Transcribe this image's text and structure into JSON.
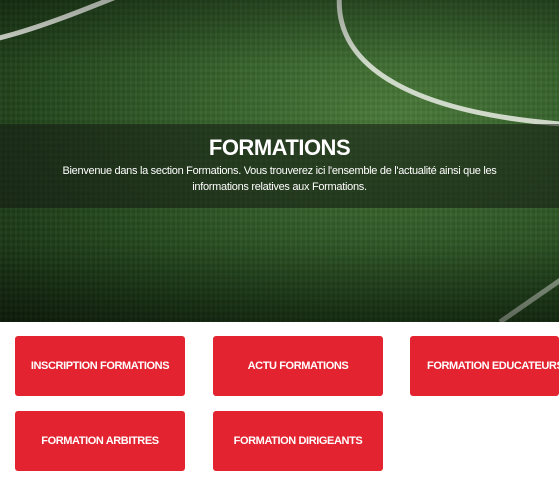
{
  "hero": {
    "title": "FORMATIONS",
    "description": "Bienvenue dans la section Formations. Vous trouverez ici l'ensemble de l'actualité ainsi que les informations relatives aux Formations."
  },
  "buttons": {
    "inscription": "INSCRIPTION FORMATIONS",
    "actu": "ACTU FORMATIONS",
    "educateurs": "FORMATION EDUCATEURS",
    "arbitres": "FORMATION ARBITRES",
    "dirigeants": "FORMATION DIRIGEANTS"
  },
  "colors": {
    "button_red": "#e32330",
    "pitch_green": "#35602b"
  }
}
